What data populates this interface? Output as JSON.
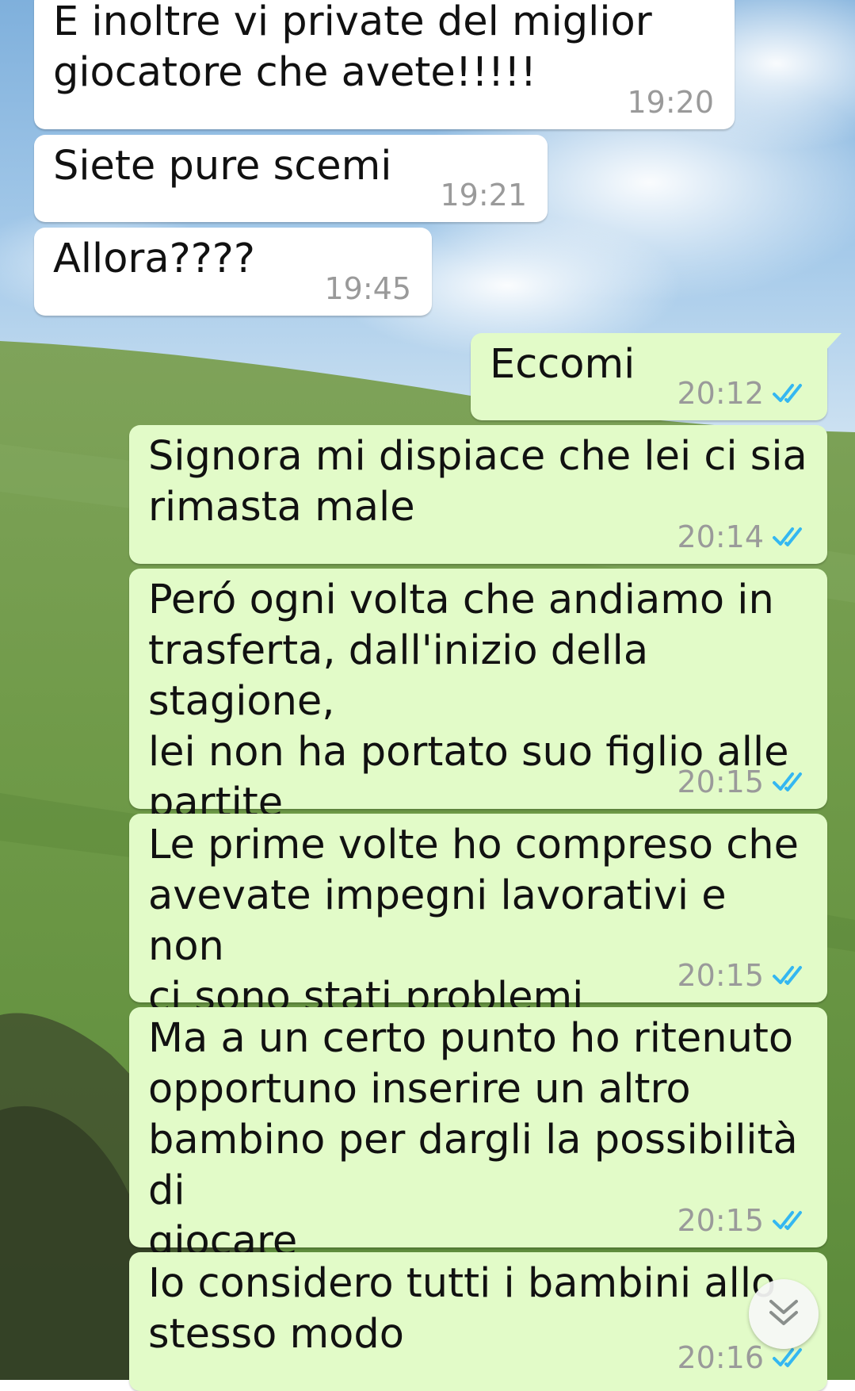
{
  "chat": {
    "messages": [
      {
        "direction": "incoming",
        "text": "E inoltre vi private del miglior\ngiocatore che avete!!!!!",
        "time": "19:20"
      },
      {
        "direction": "incoming",
        "text": "Siete pure scemi",
        "time": "19:21"
      },
      {
        "direction": "incoming",
        "text": "Allora????",
        "time": "19:45"
      },
      {
        "direction": "outgoing",
        "text": "Eccomi",
        "time": "20:12",
        "status": "read"
      },
      {
        "direction": "outgoing",
        "text": "Signora mi dispiace che lei ci sia\nrimasta male",
        "time": "20:14",
        "status": "read"
      },
      {
        "direction": "outgoing",
        "text": "Peró ogni volta che andiamo in\ntrasferta, dall'inizio della stagione,\nlei non ha portato suo figlio alle\npartite",
        "time": "20:15",
        "status": "read"
      },
      {
        "direction": "outgoing",
        "text": "Le prime volte ho compreso che\navevate impegni lavorativi e non\nci sono stati problemi",
        "time": "20:15",
        "status": "read"
      },
      {
        "direction": "outgoing",
        "text": "Ma a un certo punto ho ritenuto\nopportuno inserire un altro\nbambino per dargli la possibilità di\ngiocare",
        "time": "20:15",
        "status": "read"
      },
      {
        "direction": "outgoing",
        "text": "Io considero tutti i bambini allo\nstesso modo",
        "time": "20:16",
        "status": "read"
      }
    ]
  },
  "icons": {
    "read_receipt": "double-check-icon",
    "scroll_down": "double-chevron-down-icon"
  },
  "colors": {
    "incoming_bubble": "#ffffff",
    "outgoing_bubble": "#e2fbc8",
    "read_tick": "#34b7f1",
    "timestamp": "#9a9a9a"
  }
}
